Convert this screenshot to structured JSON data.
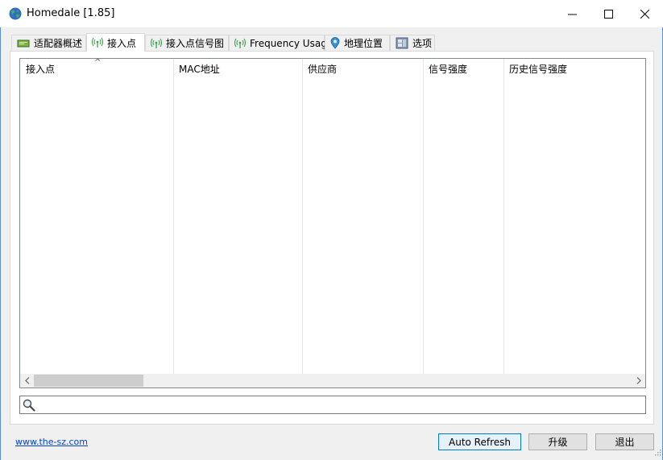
{
  "window": {
    "title": "Homedale [1.85]",
    "minimize_glyph": "—",
    "maximize_glyph": "☐",
    "close_glyph": "✕"
  },
  "tabs": [
    {
      "label": "适配器概述",
      "icon": "adapter-icon"
    },
    {
      "label": "接入点",
      "icon": "antenna-icon",
      "active": true
    },
    {
      "label": "接入点信号图",
      "icon": "antenna-icon"
    },
    {
      "label": "Frequency Usage",
      "icon": "antenna-icon"
    },
    {
      "label": "地理位置",
      "icon": "location-pin-icon"
    },
    {
      "label": "选项",
      "icon": "options-icon"
    }
  ],
  "list": {
    "columns": [
      "接入点",
      "MAC地址",
      "供应商",
      "信号强度",
      "历史信号强度"
    ],
    "sort_indicator": "^",
    "rows": []
  },
  "search": {
    "value": "",
    "placeholder": ""
  },
  "footer": {
    "link": "www.the-sz.com",
    "auto_refresh_label": "Auto Refresh",
    "upgrade_label": "升级",
    "exit_label": "退出"
  },
  "colors": {
    "window_border": "#5a8fd8",
    "default_button_border": "#0078d7",
    "link": "#0044cc"
  }
}
